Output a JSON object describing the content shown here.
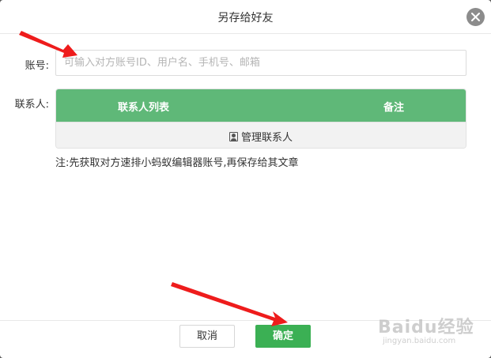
{
  "dialog": {
    "title": "另存给好友"
  },
  "account": {
    "label": "账号:",
    "placeholder": "可输入对方账号ID、用户名、手机号、邮箱",
    "value": ""
  },
  "contacts": {
    "label": "联系人:",
    "columns": [
      "联系人列表",
      "备注"
    ],
    "manage_label": "管理联系人"
  },
  "note": "注:先获取对方速排小蚂蚁编辑器账号,再保存给其文章",
  "footer": {
    "cancel_label": "取消",
    "ok_label": "确定"
  },
  "watermark": {
    "main": "Baidu经验",
    "sub": "jingyan.baidu.com"
  },
  "colors": {
    "accent": "#5fb878",
    "ok_button": "#3bb054",
    "annotation_arrow": "#ee1c1c"
  },
  "icons": {
    "close": "close-icon",
    "manage": "contact-card-icon"
  }
}
